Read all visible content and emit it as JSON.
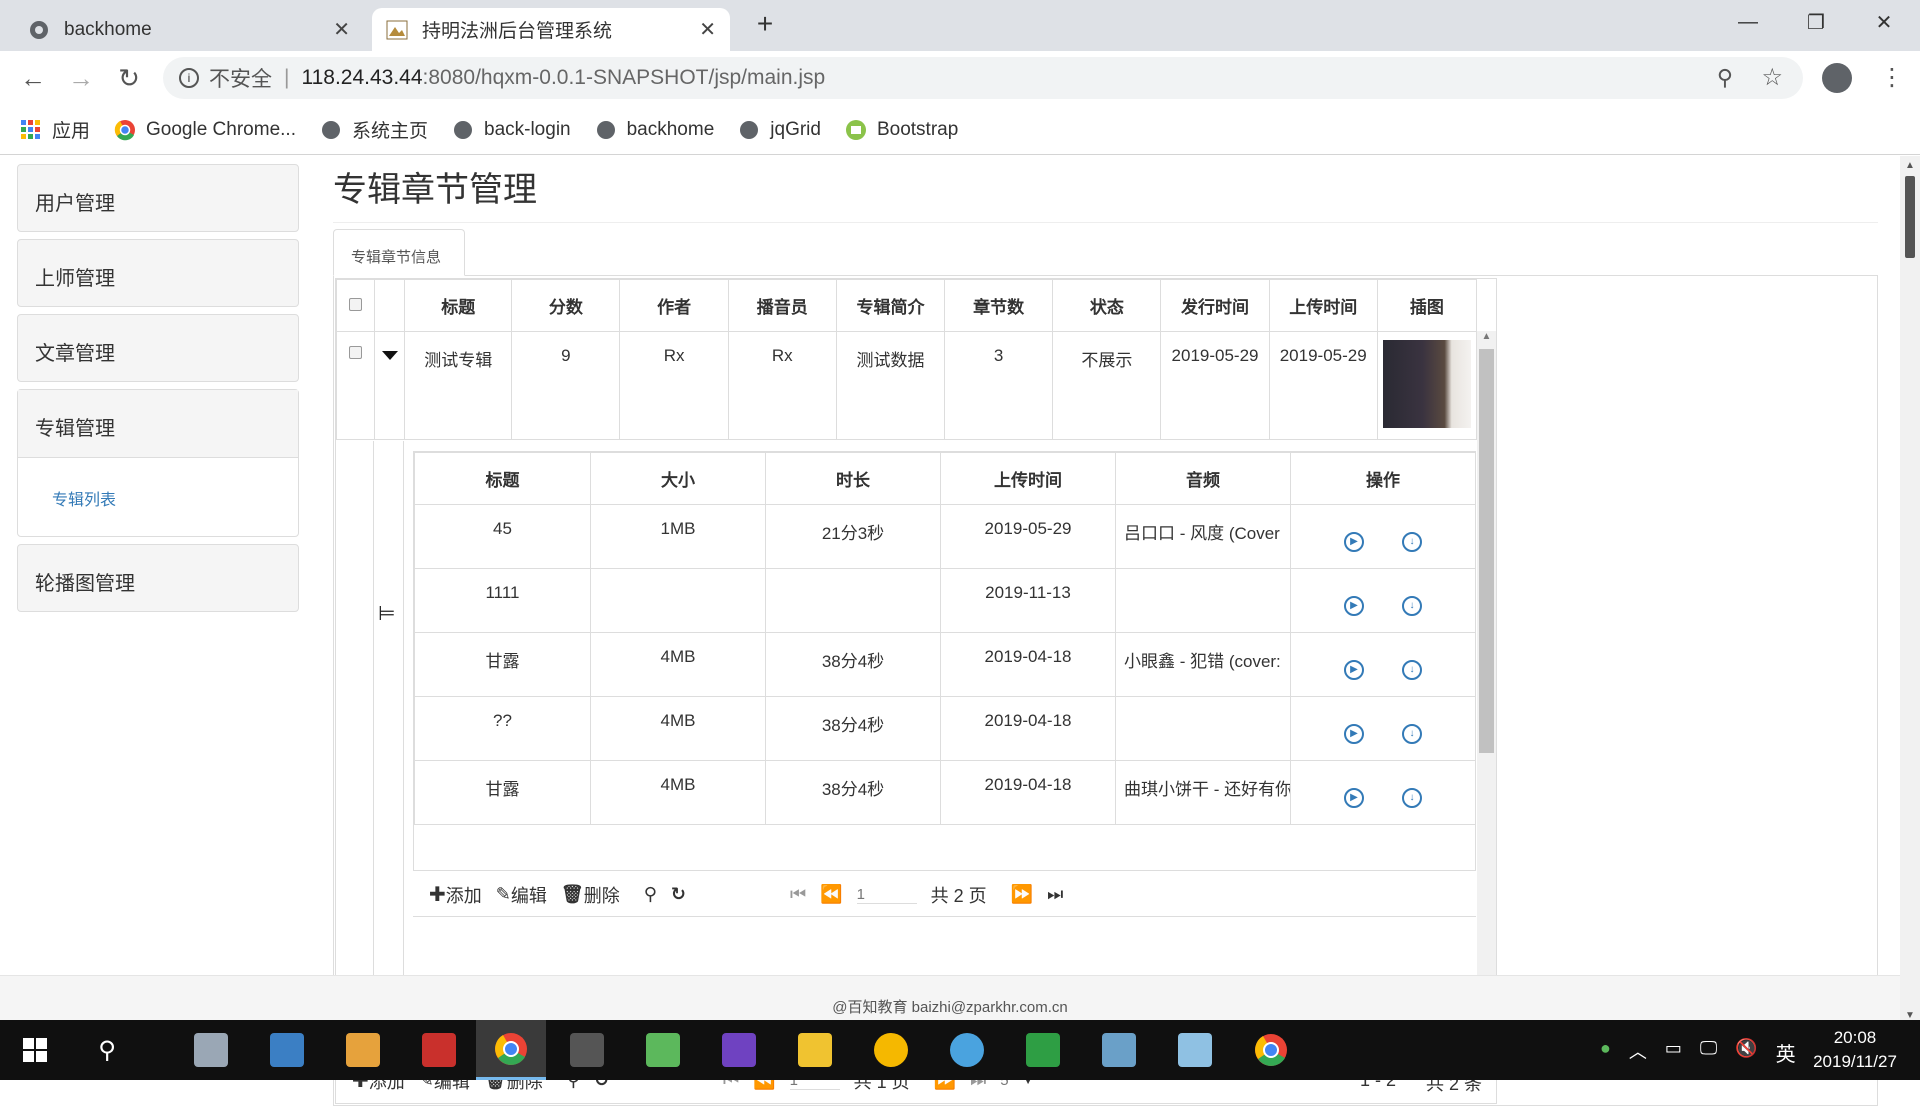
{
  "browser": {
    "tabs": [
      {
        "title": "backhome"
      },
      {
        "title": "持明法洲后台管理系统"
      }
    ],
    "url": {
      "security": "不安全",
      "host": "118.24.43.44",
      "path": ":8080/hqxm-0.0.1-SNAPSHOT/jsp/main.jsp"
    },
    "bookmarks": [
      "应用",
      "Google Chrome...",
      "系统主页",
      "back-login",
      "backhome",
      "jqGrid",
      "Bootstrap"
    ]
  },
  "sidebar": {
    "items": [
      "用户管理",
      "上师管理",
      "文章管理",
      "专辑管理",
      "轮播图管理"
    ],
    "sub": "专辑列表"
  },
  "page": {
    "title": "专辑章节管理",
    "tab": "专辑章节信息"
  },
  "grid": {
    "headers": [
      "标题",
      "分数",
      "作者",
      "播音员",
      "专辑简介",
      "章节数",
      "状态",
      "发行时间",
      "上传时间",
      "插图"
    ],
    "row": [
      "测试专辑",
      "9",
      "Rx",
      "Rx",
      "测试数据",
      "3",
      "不展示",
      "2019-05-29",
      "2019-05-29"
    ]
  },
  "subgrid": {
    "headers": [
      "标题",
      "大小",
      "时长",
      "上传时间",
      "音频",
      "操作"
    ],
    "rows": [
      [
        "45",
        "1MB",
        "21分3秒",
        "2019-05-29",
        "吕口口 - 风度 (Cover"
      ],
      [
        "1111",
        "",
        "",
        "2019-11-13",
        ""
      ],
      [
        "甘露",
        "4MB",
        "38分4秒",
        "2019-04-18",
        "小眼鑫 - 犯错 (cover:"
      ],
      [
        "??",
        "4MB",
        "38分4秒",
        "2019-04-18",
        ""
      ],
      [
        "甘露",
        "4MB",
        "38分4秒",
        "2019-04-18",
        "曲琪小饼干 - 还好有你"
      ]
    ],
    "pager": {
      "add": "添加",
      "edit": "编辑",
      "del": "删除",
      "page": "1",
      "total": "共 2 页"
    }
  },
  "pager": {
    "add": "添加",
    "edit": "编辑",
    "del": "删除",
    "page": "1",
    "total": "共 1 页",
    "rows": "5",
    "range": "1 - 2",
    "count": "共 2 条"
  },
  "footer": "@百知教育 baizhi@zparkhr.com.cn",
  "taskbar": {
    "time": "20:08",
    "date": "2019/11/27",
    "ime": "英"
  }
}
